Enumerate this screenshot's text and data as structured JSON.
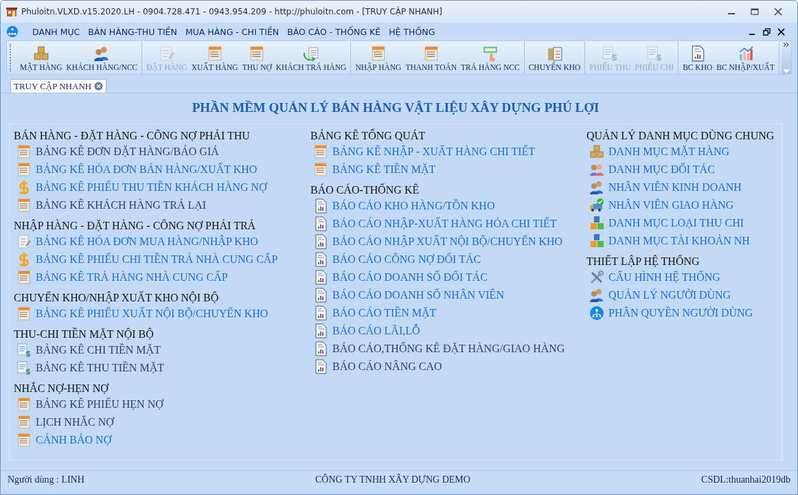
{
  "window": {
    "title": "Phuloitn.VLXD.v15.2020.LH - 0904.728.471 - 0943.954.209 - http://phuloitn.com - [TRUY CẬP NHANH]"
  },
  "menu": [
    "DANH MỤC",
    "BÁN HÀNG-THU TIỀN",
    "MUA HÀNG - CHI TIỀN",
    "BÁO CÁO - THỐNG KÊ",
    "HỆ THỐNG"
  ],
  "toolbar": [
    [
      {
        "label": "MẶT HÀNG",
        "kind": "boxes",
        "disabled": false
      },
      {
        "label": "KHÁCH HÀNG/NCC",
        "kind": "users",
        "disabled": false
      }
    ],
    [
      {
        "label": "ĐẶT HÀNG",
        "kind": "edit",
        "disabled": true
      },
      {
        "label": "XUẤT HÀNG",
        "kind": "form",
        "disabled": false
      },
      {
        "label": "THU NỢ",
        "kind": "form",
        "disabled": false
      },
      {
        "label": "KHÁCH TRẢ HÀNG",
        "kind": "return",
        "disabled": false
      }
    ],
    [
      {
        "label": "NHẬP HÀNG",
        "kind": "form",
        "disabled": false
      },
      {
        "label": "THANH TOÁN",
        "kind": "form",
        "disabled": false
      },
      {
        "label": "TRẢ HÀNG NCC",
        "kind": "hand",
        "disabled": false
      }
    ],
    [
      {
        "label": "CHUYỂN KHO",
        "kind": "clipboard",
        "disabled": false
      }
    ],
    [
      {
        "label": "PHIẾU THU",
        "kind": "money",
        "disabled": true
      },
      {
        "label": "PHIẾU CHI",
        "kind": "money",
        "disabled": true
      }
    ],
    [
      {
        "label": "BC KHO",
        "kind": "report",
        "disabled": false
      },
      {
        "label": "BC NHẬP/XUẤT",
        "kind": "chart",
        "disabled": false
      }
    ]
  ],
  "tabs": [
    {
      "label": "TRUY CẬP NHANH",
      "selected": true
    }
  ],
  "heading": "PHẦN MỀM QUẢN LÝ BÁN HÀNG VẬT LIỆU XÂY DỰNG PHÚ LỢI",
  "columns": [
    [
      {
        "title": "BÁN HÀNG - ĐẶT HÀNG - CÔNG NỢ PHẢI THU",
        "items": [
          {
            "label": "BẢNG KÊ ĐƠN ĐẶT HÀNG/BÁO GIÁ",
            "kind": "form",
            "visited": true
          },
          {
            "label": "BẢNG KÊ HÓA ĐƠN BÁN HÀNG/XUẤT KHO",
            "kind": "form",
            "visited": false
          },
          {
            "label": "BẢNG KÊ PHIẾU THU TIỀN KHÁCH HÀNG NỢ",
            "kind": "dollar",
            "visited": false
          },
          {
            "label": "BẢNG KÊ KHÁCH HÀNG TRẢ LẠI",
            "kind": "form",
            "visited": true
          }
        ]
      },
      {
        "title": "NHẬP HÀNG - ĐẶT HÀNG - CÔNG NỢ PHẢI TRẢ",
        "items": [
          {
            "label": "BẢNG KÊ HÓA ĐƠN MUA HÀNG/NHẬP KHO",
            "kind": "edit",
            "visited": false
          },
          {
            "label": "BẢNG KÊ PHIẾU CHI TIỀN TRẢ NHÀ CUNG CẤP",
            "kind": "dollar",
            "visited": false
          },
          {
            "label": "BẢNG KÊ TRẢ HÀNG NHÀ CUNG CẤP",
            "kind": "form",
            "visited": false
          }
        ]
      },
      {
        "title": "CHUYỂN KHO/NHẬP XUẤT KHO NỘI BỘ",
        "items": [
          {
            "label": "BẢNG KÊ PHIẾU XUẤT NỘI BỘ/CHUYỂN KHO",
            "kind": "form",
            "visited": false
          }
        ]
      },
      {
        "title": "THU-CHI TIỀN MẶT NỘI BỘ",
        "items": [
          {
            "label": "BẢNG KÊ CHI TIỀN MẶT",
            "kind": "money",
            "visited": true
          },
          {
            "label": "BẢNG KÊ THU TIỀN MẶT",
            "kind": "money",
            "visited": true
          }
        ]
      },
      {
        "title": "NHẮC NỢ-HẸN NỢ",
        "items": [
          {
            "label": "BẢNG KÊ PHIẾU HẸN NỢ",
            "kind": "form",
            "visited": true
          },
          {
            "label": "LỊCH NHẮC NỢ",
            "kind": "form",
            "visited": true
          },
          {
            "label": "CẢNH BẢO NỢ",
            "kind": "form",
            "visited": false
          }
        ]
      }
    ],
    [
      {
        "title": "BẢNG KÊ TỔNG QUÁT",
        "items": [
          {
            "label": "BẢNG KÊ NHẬP - XUẤT HÀNG CHI TIẾT",
            "kind": "form",
            "visited": false
          },
          {
            "label": "BẢNG KÊ TIỀN MẶT",
            "kind": "form",
            "visited": false
          }
        ]
      },
      {
        "title": "BÁO CÁO-THỐNG KÊ",
        "items": [
          {
            "label": "BÁO CÁO KHO HÀNG/TỒN KHO",
            "kind": "report",
            "visited": false
          },
          {
            "label": "BÁO CÁO NHẬP-XUẤT HÀNG HÓA CHI TIẾT",
            "kind": "report",
            "visited": false
          },
          {
            "label": "BÁO CÁO NHẬP XUẤT NỘI BỘ/CHUYỂN KHO",
            "kind": "report",
            "visited": false
          },
          {
            "label": "BÁO CÁO CÔNG NỢ ĐỐI TÁC",
            "kind": "report",
            "visited": false
          },
          {
            "label": "BÁO CÁO DOANH SỐ ĐỐI TÁC",
            "kind": "report",
            "visited": false
          },
          {
            "label": "BÁO CÁO DOANH SỐ NHÂN VIÊN",
            "kind": "report",
            "visited": false
          },
          {
            "label": "BÁO CÁO TIỀN MẶT",
            "kind": "report",
            "visited": false
          },
          {
            "label": "BÁO CÁO LÃI,LỖ",
            "kind": "report",
            "visited": false
          },
          {
            "label": "BÁO CÁO,THỐNG KÊ ĐẶT HÀNG/GIAO HÀNG",
            "kind": "report",
            "visited": true
          },
          {
            "label": "BÁO CÁO NÂNG CAO",
            "kind": "report",
            "visited": true
          }
        ]
      }
    ],
    [
      {
        "title": "QUẢN LÝ DANH MỤC DÙNG CHUNG",
        "items": [
          {
            "label": "DANH MỤC MẶT HÀNG",
            "kind": "boxes",
            "visited": false
          },
          {
            "label": "DANH MỤC ĐỐI TÁC",
            "kind": "partners",
            "visited": false
          },
          {
            "label": "NHÂN VIÊN KINH DOANH",
            "kind": "users",
            "visited": false
          },
          {
            "label": "NHÂN VIÊN GIAO HÀNG",
            "kind": "truck",
            "visited": false
          },
          {
            "label": "DANH MỤC LOẠI THU CHI",
            "kind": "blocks",
            "visited": false
          },
          {
            "label": "DANH MỤC TÀI KHOẢN NH",
            "kind": "blocks",
            "visited": false
          }
        ]
      },
      {
        "title": "THIẾT LẬP HỆ THỐNG",
        "items": [
          {
            "label": "CẤU HÌNH HỆ THỐNG",
            "kind": "tools",
            "visited": false
          },
          {
            "label": "QUẢN LÝ NGƯỜI DÙNG",
            "kind": "users",
            "visited": false
          },
          {
            "label": "PHÂN QUYỀN NGƯỜI DÙNG",
            "kind": "hierarchy",
            "visited": false
          }
        ]
      }
    ]
  ],
  "status_bar": {
    "user": "Người dùng : LINH",
    "company": "CÔNG TY TNHH XÂY DỰNG DEMO",
    "database": "CSDL:thuanhai2019db"
  }
}
